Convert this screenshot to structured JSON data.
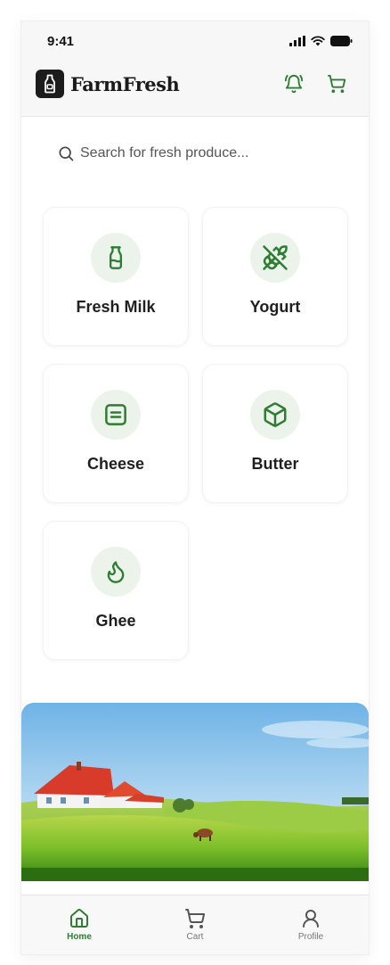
{
  "status_bar": {
    "time": "9:41"
  },
  "header": {
    "app_title": "FarmFresh"
  },
  "search": {
    "placeholder": "Search for fresh produce..."
  },
  "categories": [
    {
      "label": "Fresh Milk",
      "icon": "milk-bottle-icon"
    },
    {
      "label": "Yogurt",
      "icon": "wheat-off-icon"
    },
    {
      "label": "Cheese",
      "icon": "cheese-icon"
    },
    {
      "label": "Butter",
      "icon": "box-icon"
    },
    {
      "label": "Ghee",
      "icon": "flame-icon"
    }
  ],
  "bottom_nav": {
    "items": [
      {
        "label": "Home",
        "icon": "home-icon",
        "active": true
      },
      {
        "label": "Cart",
        "icon": "cart-icon",
        "active": false
      },
      {
        "label": "Profile",
        "icon": "user-icon",
        "active": false
      }
    ]
  },
  "colors": {
    "accent": "#2e7d32",
    "icon_circle": "#ebf3ea",
    "logo_bg": "#1c1c1c"
  }
}
